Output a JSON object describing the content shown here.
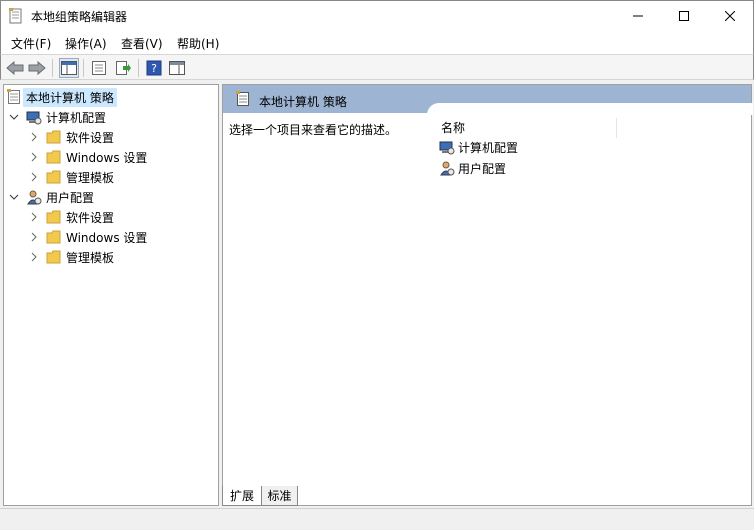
{
  "window": {
    "title": "本地组策略编辑器"
  },
  "menu": {
    "file": "文件(F)",
    "action": "操作(A)",
    "view": "查看(V)",
    "help": "帮助(H)"
  },
  "tree": {
    "root": "本地计算机 策略",
    "computer_config": "计算机配置",
    "computer_children": [
      "软件设置",
      "Windows 设置",
      "管理模板"
    ],
    "user_config": "用户配置",
    "user_children": [
      "软件设置",
      "Windows 设置",
      "管理模板"
    ]
  },
  "right": {
    "header_title": "本地计算机 策略",
    "description": "选择一个项目来查看它的描述。",
    "column_name": "名称",
    "items": [
      "计算机配置",
      "用户配置"
    ]
  },
  "tabs": {
    "extended": "扩展",
    "standard": "标准"
  },
  "colors": {
    "header_blue": "#9db4d3",
    "selection": "#cce8ff",
    "folder": "#f2c94c"
  }
}
